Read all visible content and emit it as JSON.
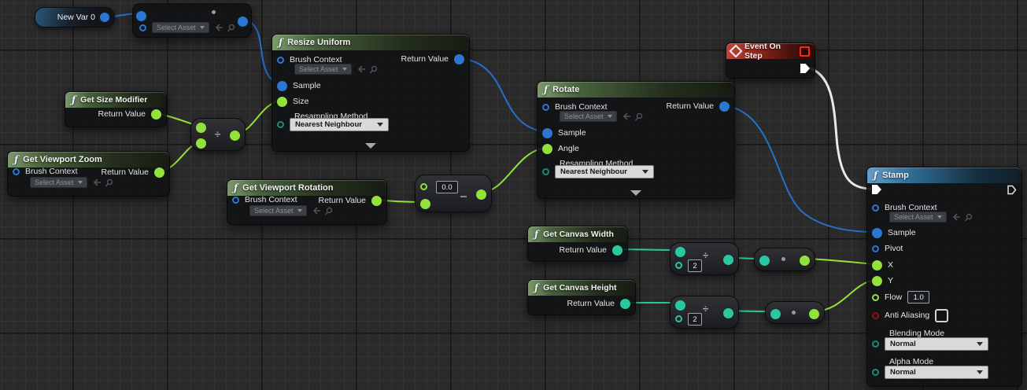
{
  "common": {
    "fn_icon": "ƒ",
    "select_asset": "Select Asset",
    "brush_context": "Brush Context",
    "sample": "Sample",
    "return_value": "Return Value",
    "resampling_method": "Resampling Method",
    "nearest_neighbour": "Nearest Neighbour",
    "normal": "Normal",
    "divide_symbol": "÷"
  },
  "nodes": {
    "new_var": {
      "label": "New Var 0"
    },
    "resize_uniform": {
      "title": "Resize Uniform",
      "size": "Size"
    },
    "get_size_modifier": {
      "title": "Get Size Modifier"
    },
    "get_viewport_zoom": {
      "title": "Get Viewport Zoom"
    },
    "get_viewport_rotation": {
      "title": "Get Viewport Rotation"
    },
    "rotate": {
      "title": "Rotate",
      "angle": "Angle"
    },
    "event_on_step": {
      "title": "Event On Step"
    },
    "get_canvas_width": {
      "title": "Get Canvas Width"
    },
    "get_canvas_height": {
      "title": "Get Canvas Height"
    },
    "stamp": {
      "title": "Stamp",
      "pivot": "Pivot",
      "x": "X",
      "y": "Y",
      "flow": "Flow",
      "flow_value": "1.0",
      "anti_aliasing": "Anti Aliasing",
      "blending_mode": "Blending Mode",
      "alpha_mode": "Alpha Mode"
    },
    "math": {
      "rotation_offset": "0.0",
      "half_divisor": "2"
    }
  },
  "colors": {
    "wire_blue": "#2470cc",
    "wire_green": "#95e33c",
    "wire_teal": "#2bc7a1",
    "wire_exec": "#e9e9e9",
    "header_green": "#47603c",
    "header_red": "#8e251d",
    "header_blue": "#2f6a94"
  }
}
